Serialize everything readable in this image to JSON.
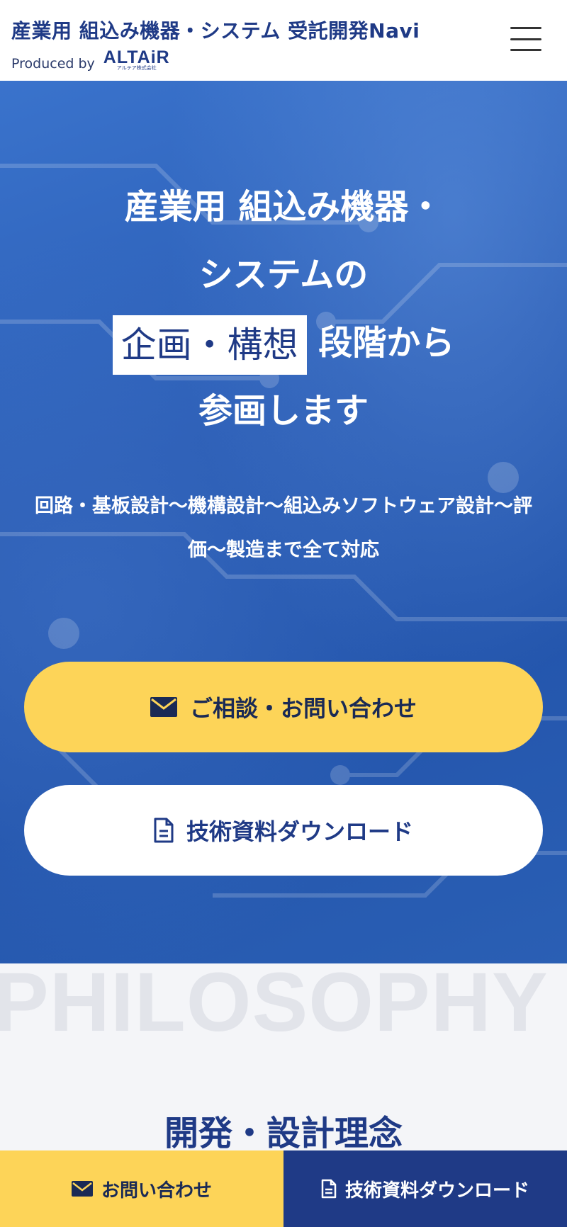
{
  "header": {
    "title": "産業用 組込み機器・システム 受託開発Navi",
    "produced_by": "Produced by",
    "logo_text": "ALTAiR",
    "logo_subtext": "アルテア株式会社"
  },
  "hero": {
    "line1": "産業用 組込み機器・",
    "line2": "システムの",
    "highlight": "企画・構想",
    "line3_rest": "段階から",
    "line4": "参画します",
    "subtext": "回路・基板設計〜機構設計〜組込みソフトウェア設計〜評価〜製造まで全て対応",
    "contact_button": "ご相談・お問い合わせ",
    "download_button": "技術資料ダウンロード"
  },
  "philosophy": {
    "watermark": "PHILOSOPHY",
    "title": "開発・設計理念"
  },
  "bottom_bar": {
    "contact": "お問い合わせ",
    "download": "技術資料ダウンロード"
  },
  "icons": {
    "mail": "mail-icon",
    "document": "document-icon",
    "menu": "hamburger-menu-icon"
  },
  "colors": {
    "brand_navy": "#1f3a86",
    "accent_yellow": "#fdd458",
    "hero_blue": "#2a5cb4",
    "section_bg": "#f4f5f8"
  }
}
